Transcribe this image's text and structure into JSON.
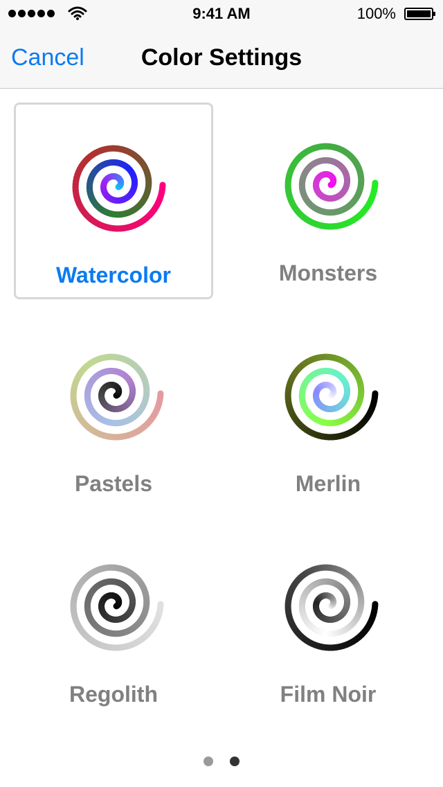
{
  "status_bar": {
    "time": "9:41 AM",
    "battery_text": "100%",
    "signal_icon": "signal-dots-icon",
    "wifi_icon": "wifi-icon",
    "battery_icon": "battery-full-icon"
  },
  "nav": {
    "cancel_label": "Cancel",
    "title": "Color Settings"
  },
  "colors": {
    "accent": "#0b7bf1",
    "label_inactive": "#808080",
    "selected_border": "#d7d7d7"
  },
  "themes": [
    {
      "label": "Watercolor",
      "selected": true,
      "icon": "watercolor-spiral-icon",
      "stops": [
        "#ff0080",
        "#b23030",
        "#2e7d32",
        "#2020ff",
        "#a020f0",
        "#00d0ff"
      ]
    },
    {
      "label": "Monsters",
      "selected": false,
      "icon": "monsters-spiral-icon",
      "stops": [
        "#22ee22",
        "#44aa44",
        "#888888",
        "#cc44cc",
        "#ff00ff"
      ]
    },
    {
      "label": "Pastels",
      "selected": false,
      "icon": "pastels-spiral-icon",
      "stops": [
        "#e59aa0",
        "#c0d890",
        "#a8c0e8",
        "#b080d0",
        "#404040",
        "#000000"
      ]
    },
    {
      "label": "Merlin",
      "selected": false,
      "icon": "merlin-spiral-icon",
      "stops": [
        "#000000",
        "#6a7a20",
        "#88ff44",
        "#66f0d0",
        "#8888ff",
        "#ffffff"
      ]
    },
    {
      "label": "Regolith",
      "selected": false,
      "icon": "regolith-spiral-icon",
      "stops": [
        "#e0e0e0",
        "#b0b0b0",
        "#808080",
        "#555555",
        "#222222",
        "#000000"
      ]
    },
    {
      "label": "Film Noir",
      "selected": false,
      "icon": "film-noir-spiral-icon",
      "stops": [
        "#000000",
        "#444444",
        "#ffffff",
        "#888888",
        "#222222",
        "#ffffff"
      ]
    }
  ],
  "pager": {
    "current_page": 2,
    "total_pages": 2
  }
}
